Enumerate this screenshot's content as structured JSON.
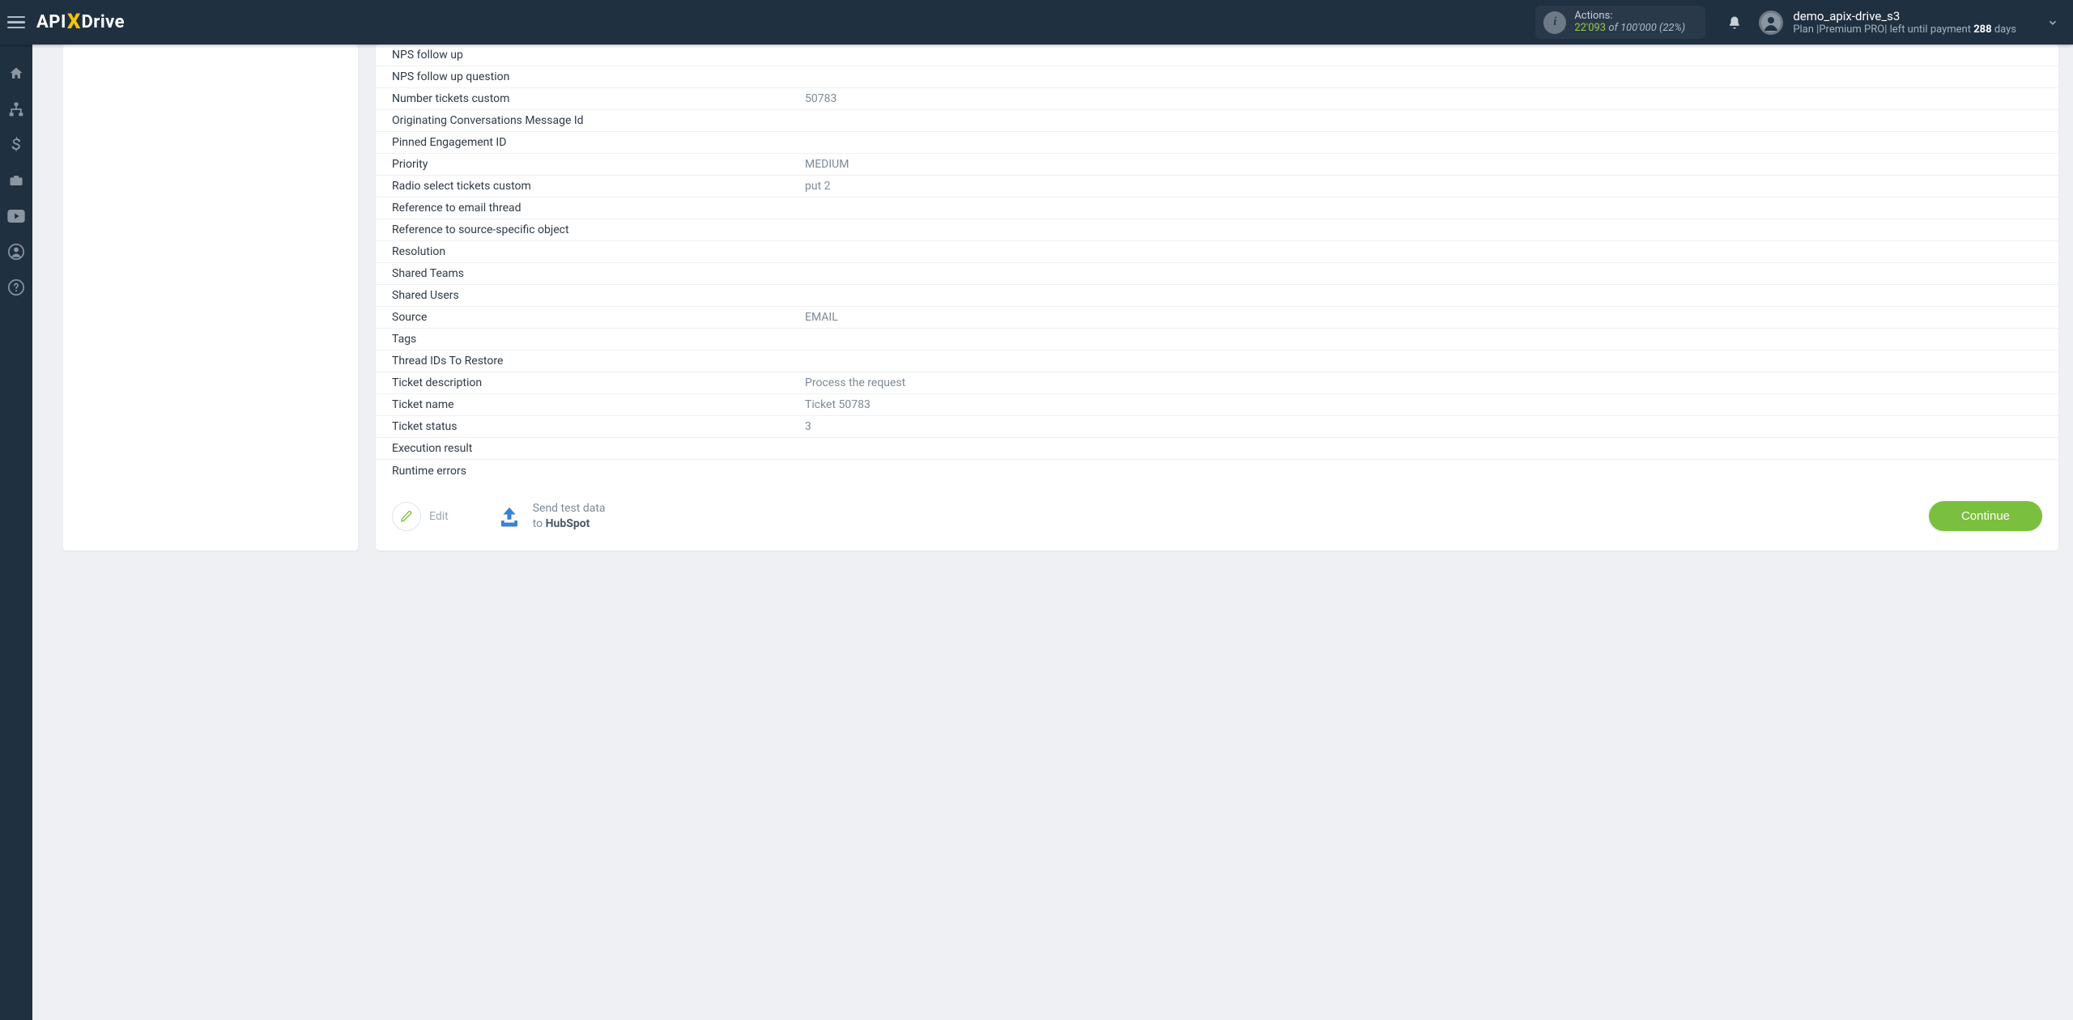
{
  "header": {
    "logo_pre": "API",
    "logo_post": "Drive",
    "actions_label": "Actions:",
    "actions_used": "22'093",
    "actions_of": " of ",
    "actions_total": "100'000",
    "actions_pct": " (22%)",
    "user_name": "demo_apix-drive_s3",
    "plan_prefix": "Plan |",
    "plan_name": "Premium PRO",
    "plan_mid": "| left until payment ",
    "plan_days": "288",
    "plan_suffix": " days"
  },
  "rows": [
    {
      "label": "NPS follow up",
      "value": ""
    },
    {
      "label": "NPS follow up question",
      "value": ""
    },
    {
      "label": "Number tickets custom",
      "value": "50783"
    },
    {
      "label": "Originating Conversations Message Id",
      "value": ""
    },
    {
      "label": "Pinned Engagement ID",
      "value": ""
    },
    {
      "label": "Priority",
      "value": "MEDIUM"
    },
    {
      "label": "Radio select tickets custom",
      "value": "put 2"
    },
    {
      "label": "Reference to email thread",
      "value": ""
    },
    {
      "label": "Reference to source-specific object",
      "value": ""
    },
    {
      "label": "Resolution",
      "value": ""
    },
    {
      "label": "Shared Teams",
      "value": ""
    },
    {
      "label": "Shared Users",
      "value": ""
    },
    {
      "label": "Source",
      "value": "EMAIL"
    },
    {
      "label": "Tags",
      "value": ""
    },
    {
      "label": "Thread IDs To Restore",
      "value": ""
    },
    {
      "label": "Ticket description",
      "value": "Process the request"
    },
    {
      "label": "Ticket name",
      "value": "Ticket 50783"
    },
    {
      "label": "Ticket status",
      "value": "3"
    },
    {
      "label": "Execution result",
      "value": ""
    },
    {
      "label": "Runtime errors",
      "value": ""
    }
  ],
  "footer": {
    "edit_label": "Edit",
    "send_line1": "Send test data",
    "send_line2_pre": "to ",
    "send_line2_target": "HubSpot",
    "continue_label": "Continue"
  }
}
